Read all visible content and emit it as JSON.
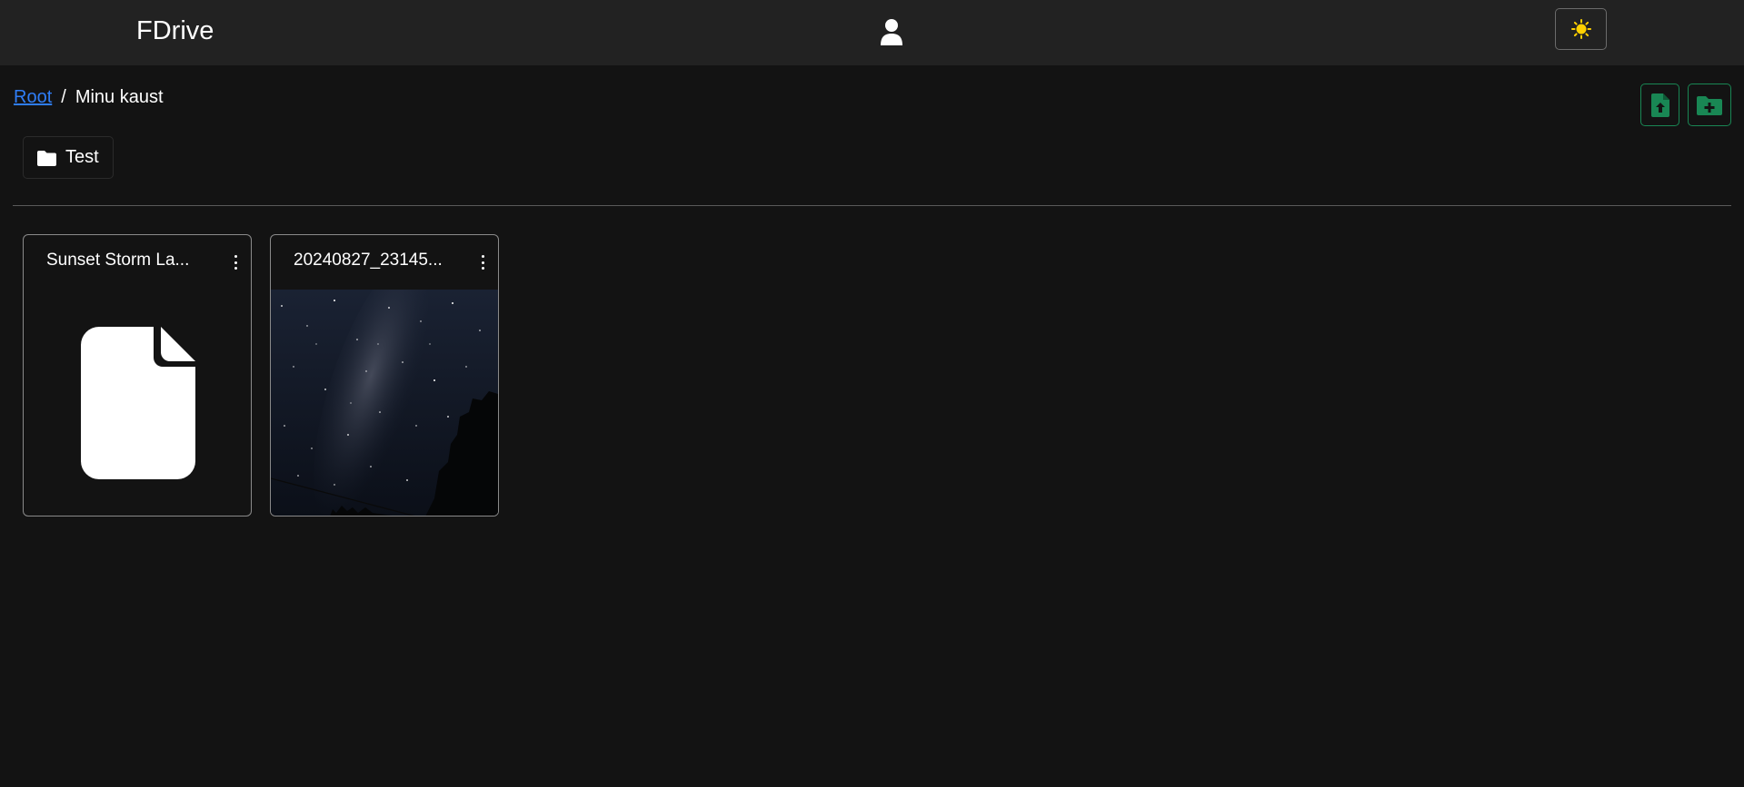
{
  "app": {
    "brand": "FDrive"
  },
  "breadcrumb": {
    "root_label": "Root",
    "separator": "/",
    "current": "Minu kaust"
  },
  "folders": [
    {
      "name": "Test"
    }
  ],
  "files": [
    {
      "title": "Sunset Storm La...",
      "preview": "document-icon"
    },
    {
      "title": "20240827_23145...",
      "preview": "night-sky-photo"
    }
  ],
  "icons": {
    "user": "user-icon",
    "theme": "sun-icon",
    "upload": "file-upload-icon",
    "new_folder": "folder-plus-icon",
    "folder": "folder-icon",
    "menu": "kebab-menu-icon"
  },
  "colors": {
    "background": "#131313",
    "navbar": "#222222",
    "accent_green": "#198754",
    "link_blue": "#2f7df6",
    "sun_yellow": "#ffd000"
  }
}
